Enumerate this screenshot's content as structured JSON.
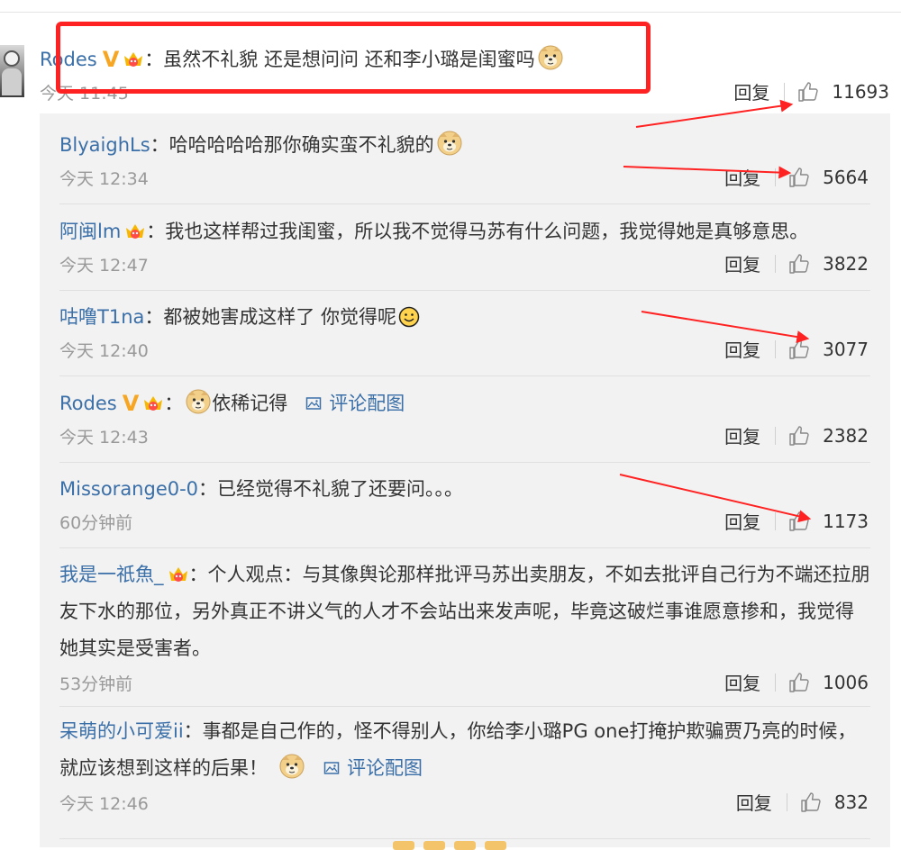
{
  "main_comment": {
    "user": "Rodes",
    "text": "：虽然不礼貌 还是想问问 还和李小璐是闺蜜吗",
    "time": "今天 11:45",
    "reply_label": "回复",
    "likes": "11693"
  },
  "replies": [
    {
      "user": "BlyaighLs",
      "text": "：哈哈哈哈哈那你确实蛮不礼貌的",
      "time": "今天 12:34",
      "reply_label": "回复",
      "likes": "5664"
    },
    {
      "user": "阿闽lm",
      "text": "：我也这样帮过我闺蜜，所以我不觉得马苏有什么问题，我觉得她是真够意思。",
      "time": "今天 12:47",
      "reply_label": "回复",
      "likes": "3822"
    },
    {
      "user": "咕噜T1na",
      "text": "：都被她害成这样了 你觉得呢",
      "time": "今天 12:40",
      "reply_label": "回复",
      "likes": "3077"
    },
    {
      "user": "Rodes",
      "text": "：",
      "text_after": "依稀记得",
      "pic_label": "评论配图",
      "time": "今天 12:43",
      "reply_label": "回复",
      "likes": "2382"
    },
    {
      "user": "Missorange0-0",
      "text": "：已经觉得不礼貌了还要问。。。",
      "time": "60分钟前",
      "reply_label": "回复",
      "likes": "1173"
    },
    {
      "user": "我是一祇魚_",
      "text": "：个人观点：与其像舆论那样批评马苏出卖朋友，不如去批评自己行为不端还拉朋友下水的那位，另外真正不讲义气的人才不会站出来发声呢，毕竟这破烂事谁愿意掺和，我觉得她其实是受害者。",
      "time": "53分钟前",
      "reply_label": "回复",
      "likes": "1006"
    },
    {
      "user": "呆萌的小可爱ii",
      "text": "：事都是自己作的，怪不得别人，你给李小璐PG one打掩护欺骗贾乃亮的时候，就应该想到这样的后果！",
      "pic_label": "评论配图",
      "time": "今天 12:46",
      "reply_label": "回复",
      "likes": "832"
    }
  ],
  "colors": {
    "username": "#3a6fa8",
    "annotation_red": "#ff2222",
    "v_badge": "#f6a623",
    "reply_bg": "#f2f2f2"
  },
  "icons": [
    "thumbs-up-icon",
    "v-verified-icon",
    "crown-icon",
    "doge-emoji-icon",
    "smile-emoji-icon",
    "picture-icon"
  ]
}
